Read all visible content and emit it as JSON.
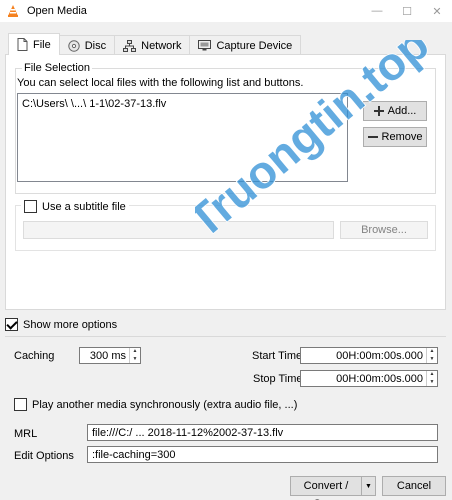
{
  "window": {
    "title": "Open Media",
    "minimize_glyph": "—",
    "maximize_glyph": "☐",
    "close_glyph": "✕"
  },
  "tabs": [
    {
      "label": "File",
      "icon": "file-icon"
    },
    {
      "label": "Disc",
      "icon": "disc-icon"
    },
    {
      "label": "Network",
      "icon": "network-icon"
    },
    {
      "label": "Capture Device",
      "icon": "capture-device-icon"
    }
  ],
  "file_selection": {
    "group_title": "File Selection",
    "hint": "You can select local files with the following list and buttons.",
    "files": [
      "C:\\Users\\        \\...\\          1-1\\02-37-13.flv"
    ],
    "add_label": "Add...",
    "remove_label": "Remove"
  },
  "subtitle": {
    "label": "Use a subtitle file",
    "checked": false,
    "path_value": "",
    "browse_label": "Browse..."
  },
  "show_more": {
    "label": "Show more options",
    "checked": true
  },
  "options": {
    "caching_label": "Caching",
    "caching_value": "300 ms",
    "start_time_label": "Start Time",
    "start_time_value": "00H:00m:00s.000",
    "stop_time_label": "Stop Time",
    "stop_time_value": "00H:00m:00s.000",
    "play_another_label": "Play another media synchronously (extra audio file, ...)",
    "play_another_checked": false,
    "mrl_label": "MRL",
    "mrl_value": "file:///C:/          ...          2018-11-12%2002-37-13.flv",
    "edit_options_label": "Edit Options",
    "edit_options_value": ":file-caching=300"
  },
  "footer": {
    "convert_label": "Convert / Save",
    "convert_dropdown_glyph": "▼",
    "cancel_label": "Cancel"
  },
  "watermark": {
    "text": "Truongtin.top",
    "color": "#2f8fd6"
  },
  "colors": {
    "vlc_orange": "#f58220"
  }
}
